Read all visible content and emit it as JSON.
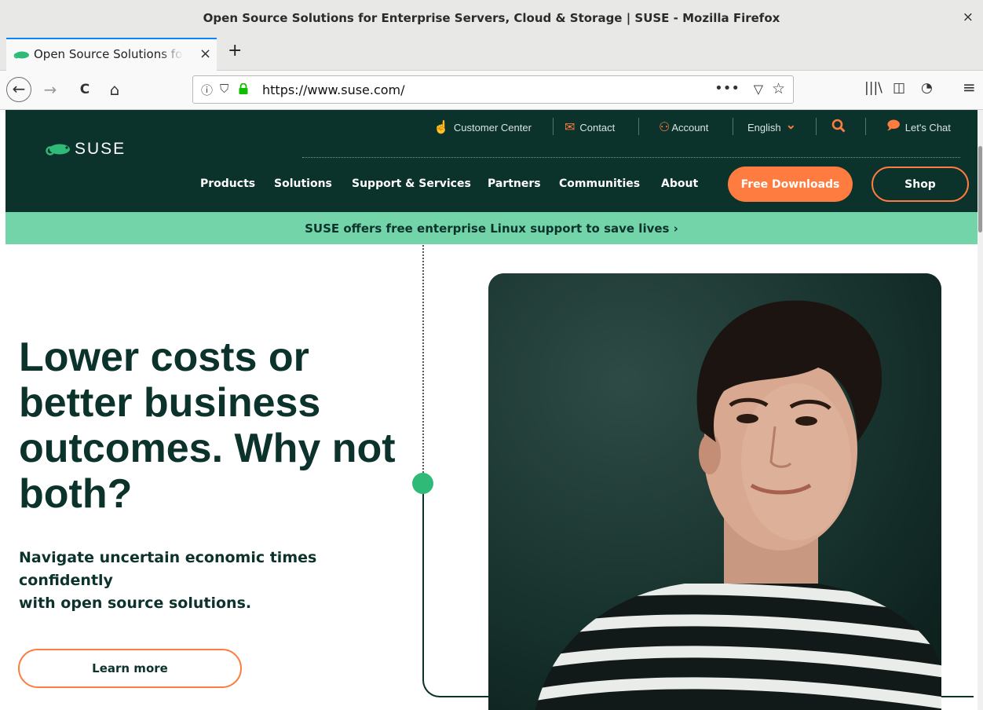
{
  "window": {
    "title": "Open Source Solutions for Enterprise Servers, Cloud & Storage | SUSE - Mozilla Firefox",
    "close_glyph": "×"
  },
  "tab": {
    "label": "Open Source Solutions for Enterprise Servers, Cloud & Storage | SUSE",
    "close_glyph": "×",
    "new_tab_glyph": "+"
  },
  "navbar": {
    "back_glyph": "←",
    "forward_glyph": "→",
    "reload_glyph": "C",
    "home_glyph": "⌂",
    "url": "https://www.suse.com/",
    "page_actions_glyph": "•••",
    "pocket_glyph": "▽",
    "bookmark_glyph": "☆",
    "library_glyph": "|||\\",
    "sidebar_glyph": "◫",
    "account_glyph": "◔",
    "menu_glyph": "≡"
  },
  "header": {
    "logo_text": "SUSE",
    "utility": {
      "customer_center": "Customer Center",
      "contact": "Contact",
      "account": "Account",
      "language": "English",
      "language_chevron": "⌄",
      "lets_chat": "Let's Chat"
    },
    "nav": [
      "Products",
      "Solutions",
      "Support & Services",
      "Partners",
      "Communities",
      "About"
    ],
    "free_downloads": "Free Downloads",
    "shop": "Shop"
  },
  "banner": {
    "text": "SUSE offers free enterprise Linux support to save lives ›"
  },
  "hero": {
    "title": "Lower costs or better business outcomes. Why not both?",
    "subtitle_line1": "Navigate uncertain economic times confidently",
    "subtitle_line2": "with open source solutions.",
    "cta": "Learn more"
  },
  "colors": {
    "brand_dark": "#0c322c",
    "brand_green": "#30ba78",
    "banner_green": "#73d4a9",
    "accent_orange": "#fe7c3f"
  }
}
